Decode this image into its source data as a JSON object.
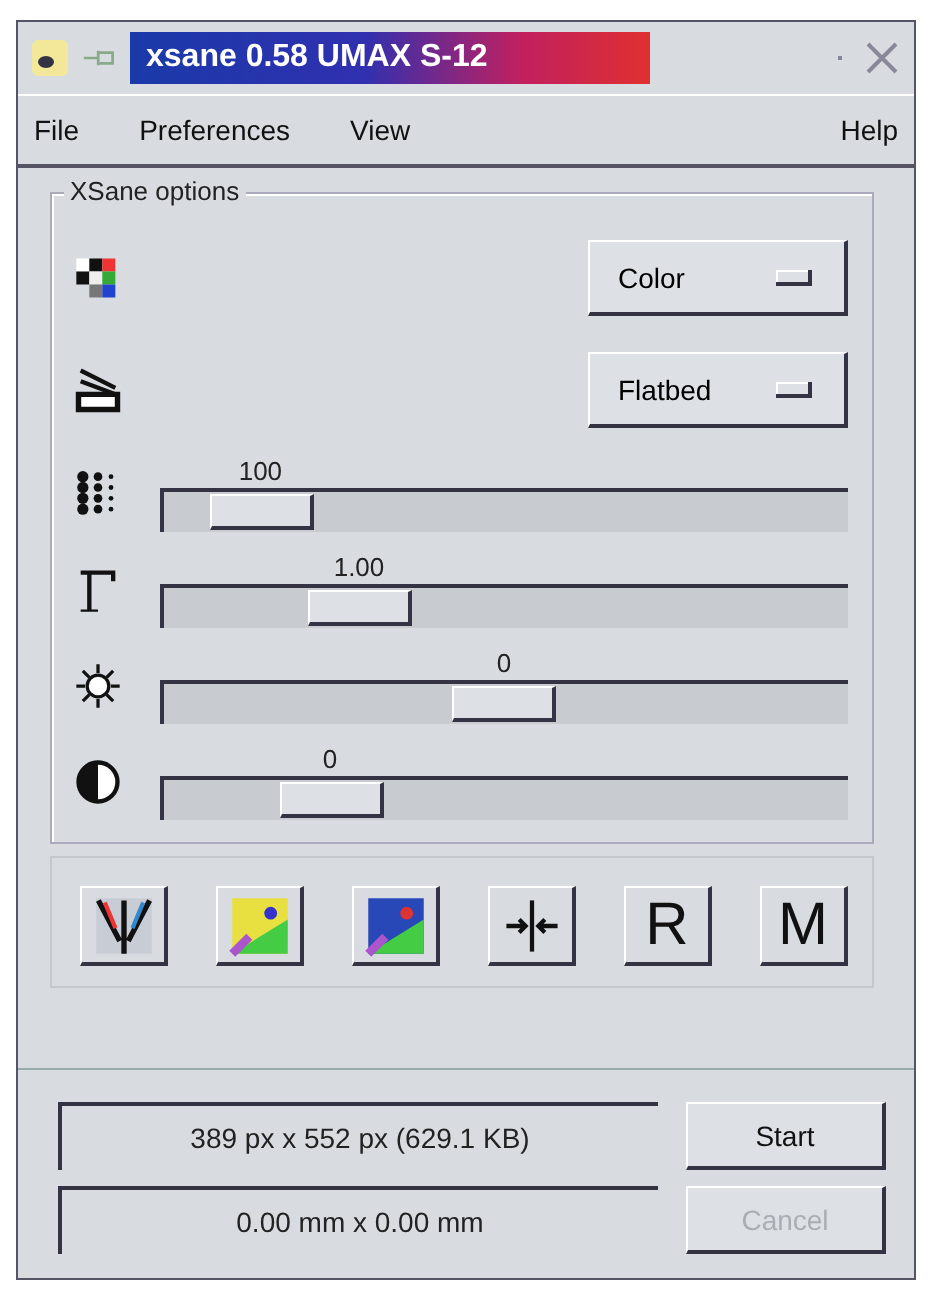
{
  "window": {
    "title": "xsane 0.58 UMAX S-12"
  },
  "menu": [
    "File",
    "Preferences",
    "View",
    "Help"
  ],
  "options": {
    "title": "XSane options",
    "rows": [
      {
        "kind": "menu",
        "value": "Color"
      },
      {
        "kind": "menu",
        "value": "Flatbed"
      },
      {
        "kind": "slider",
        "reading": "100",
        "level": 0.08
      },
      {
        "kind": "slider",
        "reading": "1.00",
        "level": 0.25
      },
      {
        "kind": "slider",
        "reading": "0",
        "level": 0.5
      },
      {
        "kind": "slider",
        "reading": "0",
        "level": 0.2
      }
    ]
  },
  "toolbar": [
    {
      "kind": "icon"
    },
    {
      "kind": "icon"
    },
    {
      "kind": "icon"
    },
    {
      "kind": "icon"
    },
    {
      "kind": "text",
      "label": "R"
    },
    {
      "kind": "text",
      "label": "M"
    }
  ],
  "info": [
    "389 px x 552 px (629.1 KB)",
    "0.00 mm x 0.00 mm"
  ],
  "buttons": [
    {
      "label": "Start",
      "disabled": false
    },
    {
      "label": "Cancel",
      "disabled": true
    }
  ]
}
